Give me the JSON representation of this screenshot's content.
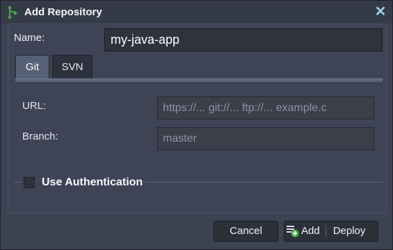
{
  "dialog": {
    "title": "Add Repository"
  },
  "form": {
    "name_label": "Name:",
    "name_value": "my-java-app",
    "tabs": [
      {
        "label": "Git",
        "active": true
      },
      {
        "label": "SVN",
        "active": false
      }
    ],
    "url_label": "URL:",
    "url_placeholder": "https://... git://... ftp://... example.c",
    "branch_label": "Branch:",
    "branch_placeholder": "master",
    "auth_label": "Use Authentication",
    "auth_checked": false
  },
  "buttons": {
    "cancel": "Cancel",
    "add": "Add",
    "deploy": "Deploy"
  },
  "colors": {
    "accent": "#4cae4c",
    "close": "#9fd2ea",
    "background": "#3b4252"
  }
}
